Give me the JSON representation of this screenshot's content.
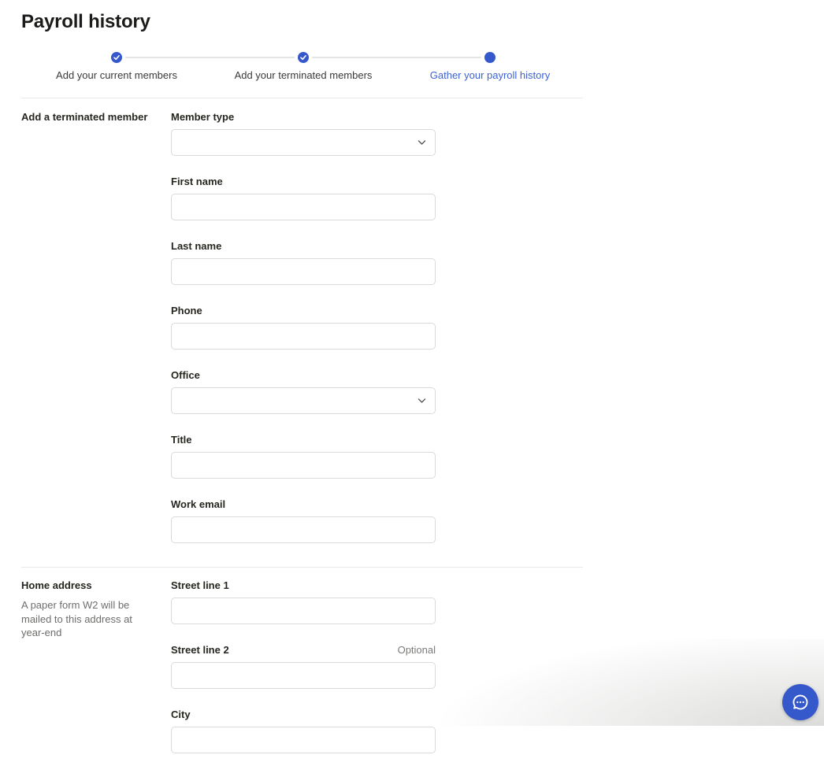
{
  "page": {
    "title": "Payroll history"
  },
  "stepper": {
    "steps": [
      {
        "label": "Add your current members",
        "state": "complete",
        "icon": "check-circle-icon"
      },
      {
        "label": "Add your terminated members",
        "state": "complete",
        "icon": "check-circle-icon"
      },
      {
        "label": "Gather your payroll history",
        "state": "active",
        "icon": "filled-dot-icon"
      }
    ]
  },
  "sections": [
    {
      "heading": "Add a terminated member",
      "help": "",
      "fields": [
        {
          "label": "Member type",
          "type": "select",
          "value": ""
        },
        {
          "label": "First name",
          "type": "text",
          "value": "",
          "placeholder": ""
        },
        {
          "label": "Last name",
          "type": "text",
          "value": "",
          "placeholder": ""
        },
        {
          "label": "Phone",
          "type": "text",
          "value": "",
          "placeholder": ""
        },
        {
          "label": "Office",
          "type": "select",
          "value": ""
        },
        {
          "label": "Title",
          "type": "text",
          "value": "",
          "placeholder": ""
        },
        {
          "label": "Work email",
          "type": "text",
          "value": "",
          "placeholder": ""
        }
      ]
    },
    {
      "heading": "Home address",
      "help": "A paper form W2 will be mailed to this address at year-end",
      "fields": [
        {
          "label": "Street line 1",
          "type": "text",
          "value": "",
          "placeholder": ""
        },
        {
          "label": "Street line 2",
          "type": "text",
          "value": "",
          "placeholder": "",
          "optional": "Optional"
        },
        {
          "label": "City",
          "type": "text",
          "value": "",
          "placeholder": ""
        }
      ]
    }
  ],
  "chat": {
    "icon": "chat-bubble-icon"
  },
  "colors": {
    "accent_blue": "#3558cb",
    "active_step_text": "#3e62d4",
    "step_connector": "#e4e4e2",
    "divider": "#e9e9e7",
    "input_border": "#d9d9de",
    "text_primary": "#26251f",
    "text_muted": "#6d6d6b"
  }
}
